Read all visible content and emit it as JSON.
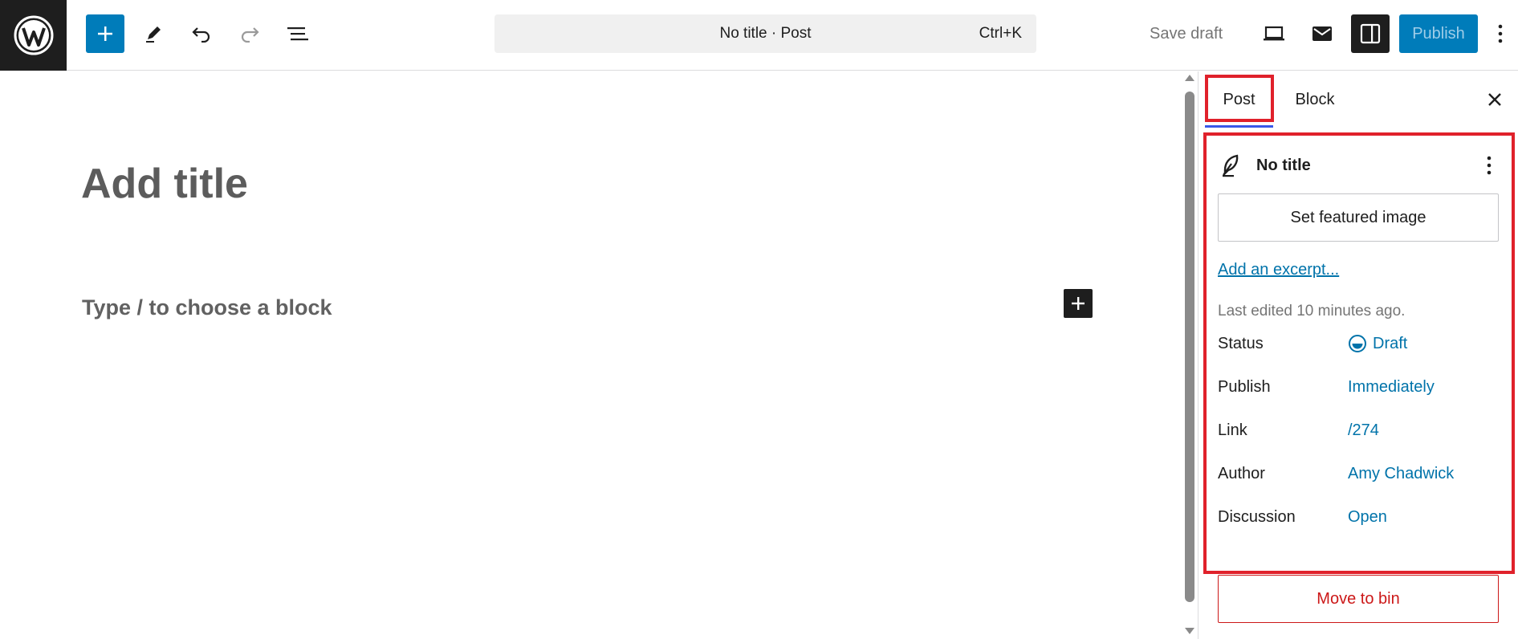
{
  "toolbar": {
    "logo_icon": "wordpress-logo-icon",
    "add_block_icon": "plus-icon",
    "tools_icon": "pencil-icon",
    "undo_icon": "undo-icon",
    "redo_icon": "redo-icon",
    "document_overview_icon": "list-view-icon",
    "command_title": "No title · Post",
    "command_shortcut": "Ctrl+K",
    "save_draft_label": "Save draft",
    "preview_icon": "laptop-icon",
    "mail_icon": "envelope-icon",
    "settings_icon": "sidebar-toggle-icon",
    "publish_label": "Publish",
    "options_icon": "vertical-ellipsis-icon",
    "accent_color": "#007cba"
  },
  "editor": {
    "title_placeholder": "Add title",
    "block_placeholder": "Type / to choose a block",
    "inserter_icon": "plus-icon"
  },
  "sidebar": {
    "tabs": [
      {
        "label": "Post",
        "active": true
      },
      {
        "label": "Block",
        "active": false
      }
    ],
    "close_icon": "close-icon",
    "summary": {
      "icon": "feather-icon",
      "title": "No title",
      "more_icon": "vertical-ellipsis-icon"
    },
    "featured_image_label": "Set featured image",
    "excerpt_link": "Add an excerpt...",
    "last_edited": "Last edited 10 minutes ago.",
    "meta": [
      {
        "label": "Status",
        "value": "Draft",
        "icon": "draft-status-icon"
      },
      {
        "label": "Publish",
        "value": "Immediately"
      },
      {
        "label": "Link",
        "value": "/274"
      },
      {
        "label": "Author",
        "value": "Amy Chadwick"
      },
      {
        "label": "Discussion",
        "value": "Open"
      }
    ],
    "move_to_bin_label": "Move to bin",
    "highlight_color": "#e0212b"
  }
}
